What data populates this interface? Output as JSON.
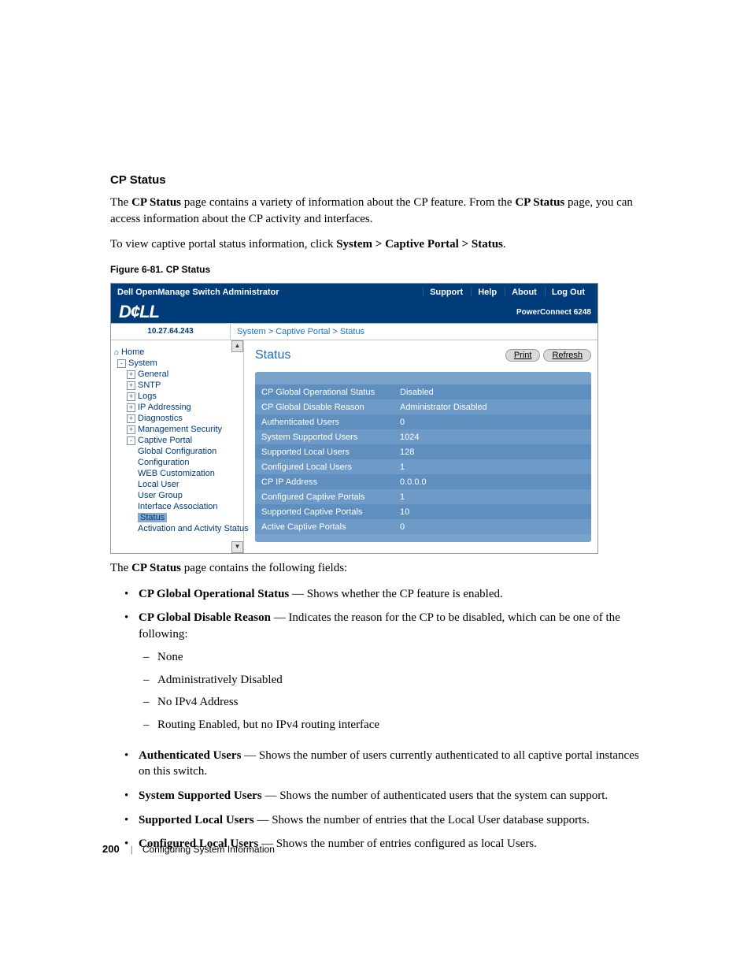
{
  "sectionTitle": "CP Status",
  "para1_a": "The ",
  "para1_b": "CP Status",
  "para1_c": " page contains a variety of information about the CP feature. From the ",
  "para1_d": "CP Status",
  "para1_e": " page, you can access information about the CP activity and interfaces.",
  "para2_a": "To view captive portal status information, click ",
  "para2_b": "System > Captive Portal > Status",
  "para2_c": ".",
  "figCaption": "Figure 6-81.    CP Status",
  "shot": {
    "topTitle": "Dell OpenManage Switch Administrator",
    "topLinks": {
      "support": "Support",
      "help": "Help",
      "about": "About",
      "logout": "Log Out"
    },
    "logo": "D¢LL",
    "model": "PowerConnect 6248",
    "ip": "10.27.64.243",
    "breadcrumb_a": "System",
    "breadcrumb_sep": " > ",
    "breadcrumb_b": "Captive Portal",
    "breadcrumb_c": "Status",
    "nav": {
      "home": "Home",
      "system": "System",
      "general": "General",
      "sntp": "SNTP",
      "logs": "Logs",
      "ipaddr": "IP Addressing",
      "diag": "Diagnostics",
      "msec": "Management Security",
      "cp": "Captive Portal",
      "gconf": "Global Configuration",
      "conf": "Configuration",
      "webcust": "WEB Customization",
      "luser": "Local User",
      "ugroup": "User Group",
      "iassoc": "Interface Association",
      "status": "Status",
      "actact": "Activation and Activity Status"
    },
    "contentTitle": "Status",
    "printBtn": "Print",
    "refreshBtn": "Refresh",
    "rows": [
      {
        "k": "CP Global Operational Status",
        "v": "Disabled"
      },
      {
        "k": "CP Global Disable Reason",
        "v": "Administrator Disabled"
      },
      {
        "k": "Authenticated Users",
        "v": "0"
      },
      {
        "k": "System Supported Users",
        "v": "1024"
      },
      {
        "k": "Supported Local Users",
        "v": "128"
      },
      {
        "k": "Configured Local Users",
        "v": "1"
      },
      {
        "k": "CP IP Address",
        "v": "0.0.0.0"
      },
      {
        "k": "Configured Captive Portals",
        "v": "1"
      },
      {
        "k": "Supported Captive Portals",
        "v": "10"
      },
      {
        "k": "Active Captive Portals",
        "v": "0"
      }
    ]
  },
  "after": {
    "lead_a": "The ",
    "lead_b": "CP Status",
    "lead_c": " page contains the following fields:",
    "b1_a": "CP Global Operational Status",
    "b1_b": " — Shows whether the CP feature is enabled.",
    "b2_a": "CP Global Disable Reason",
    "b2_b": " — Indicates the reason for the CP to be disabled, which can be one of the following:",
    "b2_s1": "None",
    "b2_s2": "Administratively Disabled",
    "b2_s3": "No IPv4 Address",
    "b2_s4": "Routing Enabled, but no IPv4 routing interface",
    "b3_a": "Authenticated Users",
    "b3_b": " — Shows the number of users currently authenticated to all captive portal instances on this switch.",
    "b4_a": "System Supported Users",
    "b4_b": " — Shows the number of authenticated users that the system can support.",
    "b5_a": "Supported Local Users",
    "b5_b": " — Shows the number of entries that the Local User database supports.",
    "b6_a": "Configured Local Users",
    "b6_b": " — Shows the number of entries configured as local Users."
  },
  "footer": {
    "page": "200",
    "chapter": "Configuring System Information"
  }
}
